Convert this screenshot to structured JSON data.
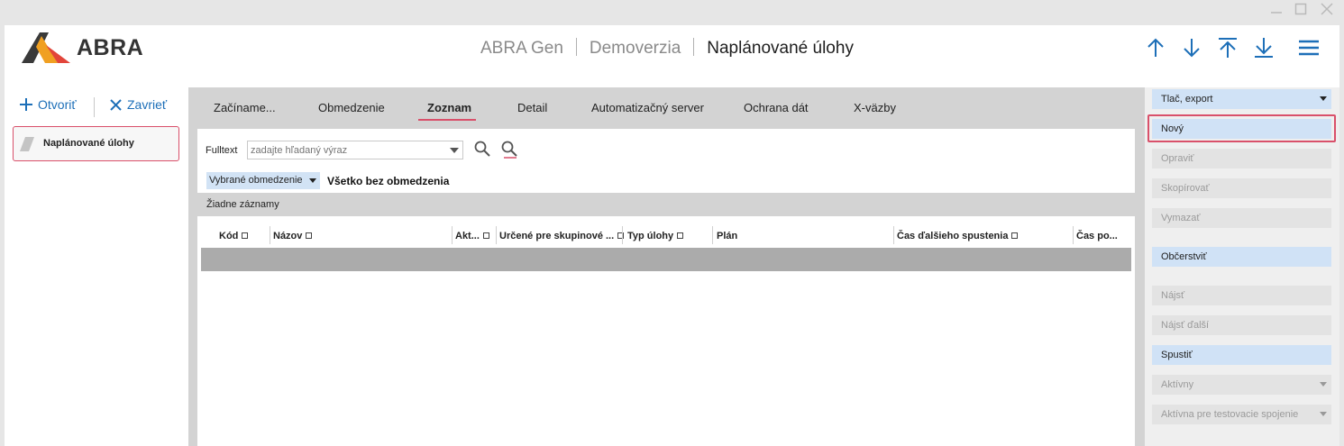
{
  "window": {
    "controls": [
      "minimize-icon",
      "maximize-icon",
      "close-icon"
    ]
  },
  "header": {
    "logo_text": "ABRA",
    "breadcrumb": [
      "ABRA Gen",
      "Demoverzia",
      "Naplánované úlohy"
    ],
    "nav_icons": [
      "arrow-up-icon",
      "arrow-down-icon",
      "arrow-to-top-icon",
      "arrow-to-bottom-icon",
      "menu-icon"
    ],
    "accent": "#1d6fb8"
  },
  "left_panel": {
    "open_label": "Otvoriť",
    "close_label": "Zavrieť",
    "items": [
      {
        "label": "Naplánované úlohy"
      }
    ]
  },
  "tabs": [
    {
      "label": "Začíname..."
    },
    {
      "label": "Obmedzenie"
    },
    {
      "label": "Zoznam",
      "active": true
    },
    {
      "label": "Detail"
    },
    {
      "label": "Automatizačný server"
    },
    {
      "label": "Ochrana dát"
    },
    {
      "label": "X-väzby"
    }
  ],
  "fulltext": {
    "label": "Fulltext",
    "placeholder": "zadajte hľadaný výraz"
  },
  "filter": {
    "select_label": "Vybrané obmedzenie",
    "value": "Všetko bez obmedzenia"
  },
  "records_status": "Žiadne záznamy",
  "grid": {
    "columns": [
      "Kód",
      "Názov",
      "Akt...",
      "Určené pre skupinové ...",
      "Typ úlohy",
      "Plán",
      "Čas ďalšieho spustenia",
      "Čas po..."
    ]
  },
  "actions": {
    "print_export": "Tlač, export",
    "new": "Nový",
    "edit": "Opraviť",
    "copy": "Skopírovať",
    "delete": "Vymazať",
    "refresh": "Občerstviť",
    "find": "Nájsť",
    "find_next": "Nájsť ďalší",
    "run": "Spustiť",
    "active": "Aktívny",
    "active_test": "Aktívna pre testovacie spojenie"
  },
  "colors": {
    "highlight": "#d9506a",
    "action_blue": "#d0e2f6"
  }
}
